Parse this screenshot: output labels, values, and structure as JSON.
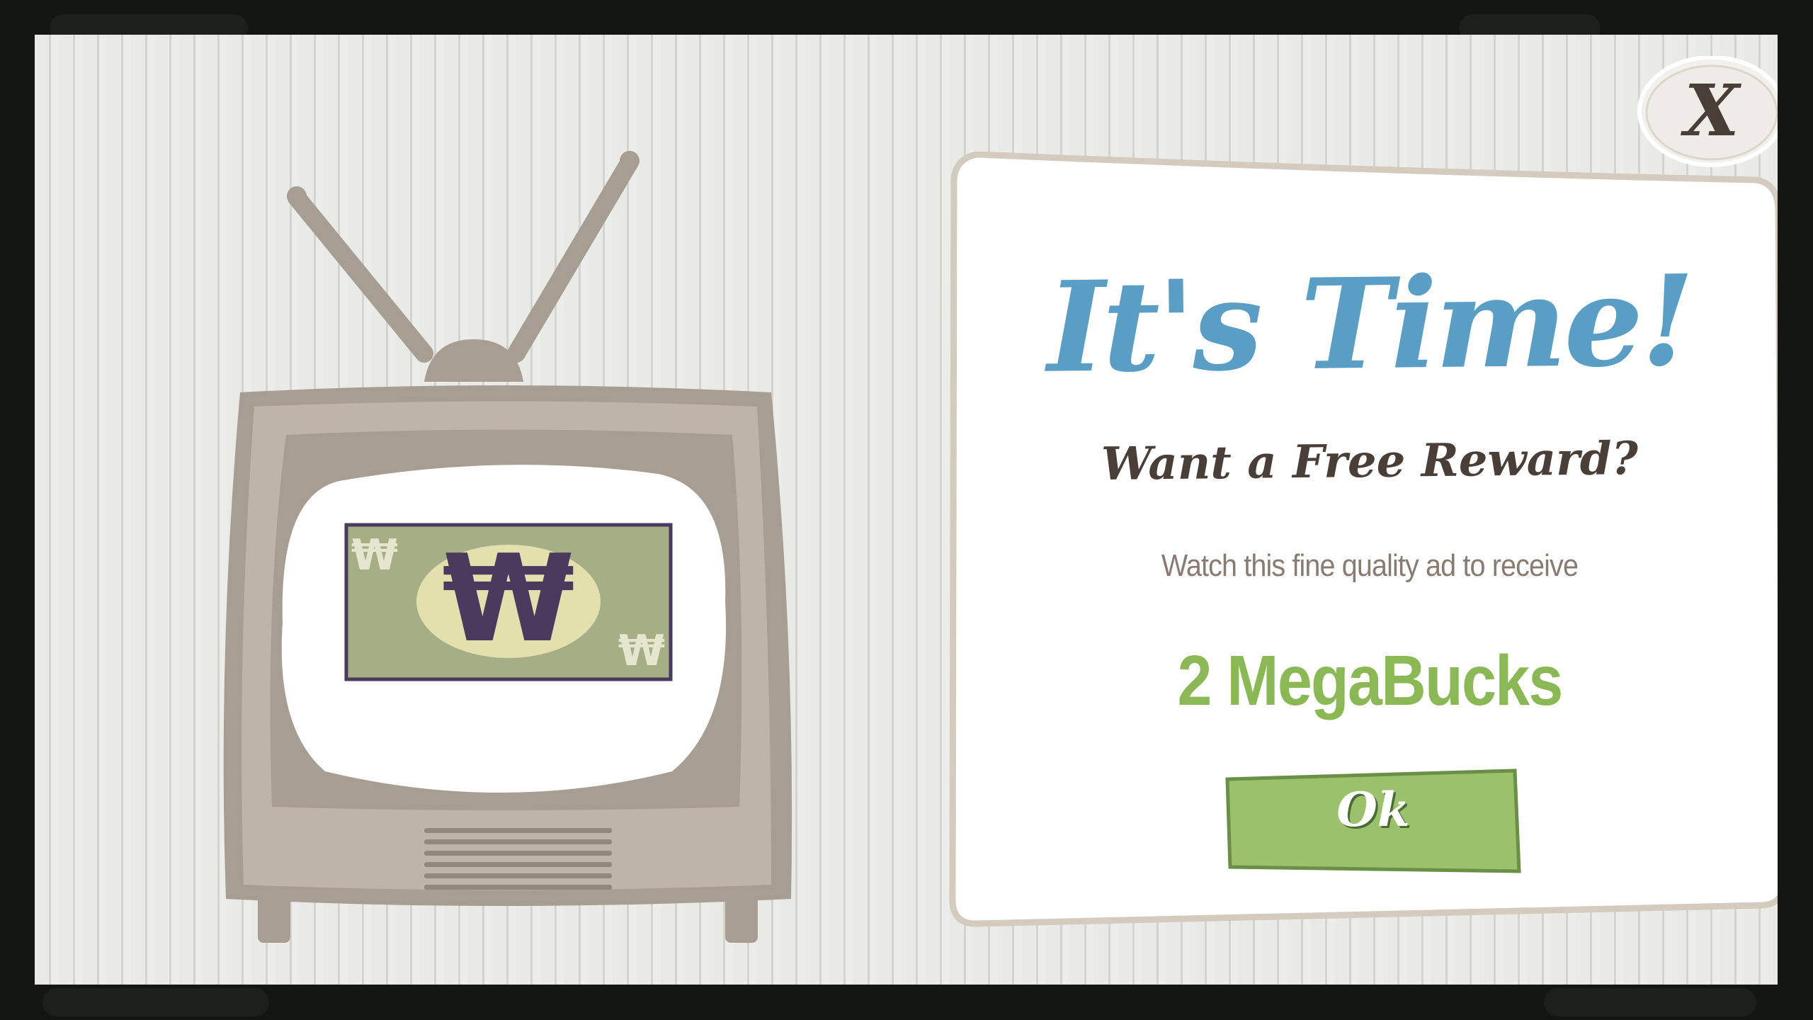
{
  "dialog": {
    "title": "It's Time!",
    "subtitle": "Want a Free Reward?",
    "description": "Watch this fine quality ad to receive",
    "reward": "2 MegaBucks",
    "ok_label": "Ok",
    "close_label": "X"
  },
  "tv": {
    "bill_symbol": "₩"
  },
  "colors": {
    "title": "#5a9ec5",
    "reward": "#8ab855",
    "button": "#9cc16c",
    "tv_body": "#a69e92",
    "bill": "#a6ae86",
    "bill_symbol": "#4a3a5e"
  }
}
